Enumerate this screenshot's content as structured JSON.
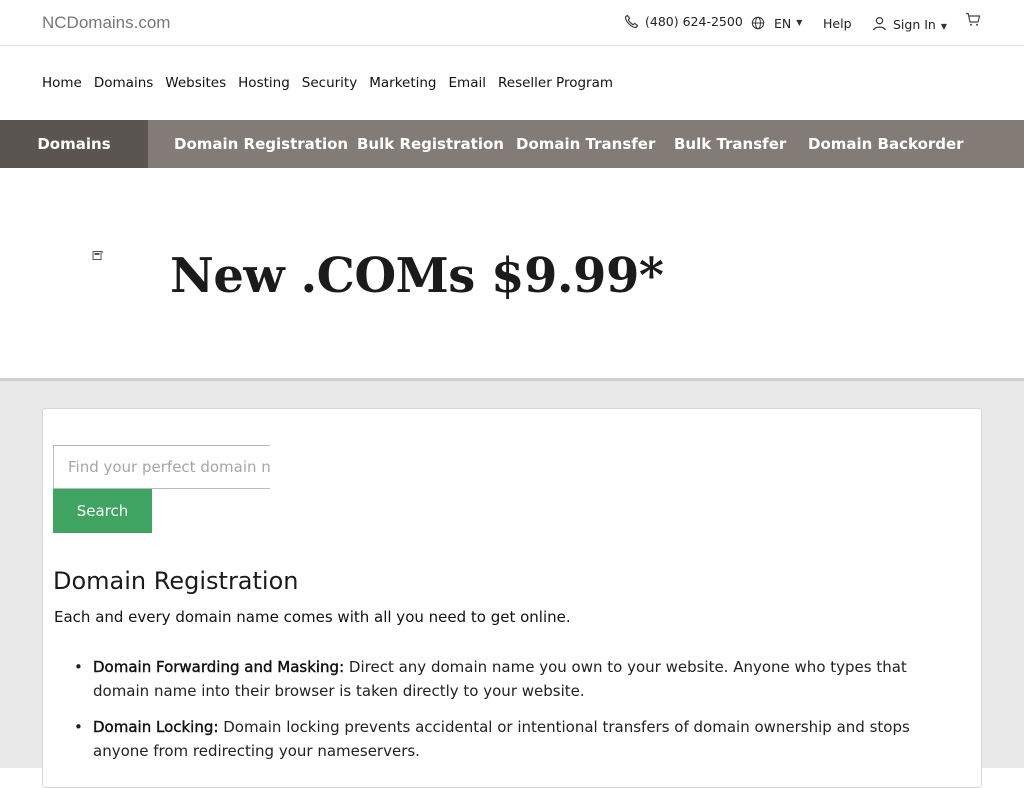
{
  "topbar": {
    "logo": "NCDomains.com",
    "phone": "(480) 624-2500",
    "language": "EN",
    "help": "Help",
    "sign_in": "Sign In"
  },
  "main_nav": [
    "Home",
    "Domains",
    "Websites",
    "Hosting",
    "Security",
    "Marketing",
    "Email",
    "Reseller Program"
  ],
  "sub_nav": {
    "section": "Domains",
    "items": [
      "Domain Registration",
      "Bulk Registration",
      "Domain Transfer",
      "Bulk Transfer",
      "Domain Backorder"
    ],
    "active_index": 0
  },
  "hero": {
    "headline": "New .COMs $9.99*"
  },
  "search": {
    "placeholder": "Find your perfect domain name",
    "button": "Search"
  },
  "content": {
    "title": "Domain Registration",
    "subtitle": "Each and every domain name comes with all you need to get online.",
    "features": [
      {
        "term": "Domain Forwarding and Masking:",
        "text": "Direct any domain name you own to your website. Anyone who types that domain name into their browser is taken directly to your website."
      },
      {
        "term": "Domain Locking:",
        "text": "Domain locking prevents accidental or intentional transfers of domain ownership and stops anyone from redirecting your nameservers."
      }
    ]
  },
  "colors": {
    "subnav_bg": "#837b75",
    "subnav_section_bg": "#5b5552",
    "search_button": "#3fa361",
    "page_bg": "#e9e9e9"
  }
}
